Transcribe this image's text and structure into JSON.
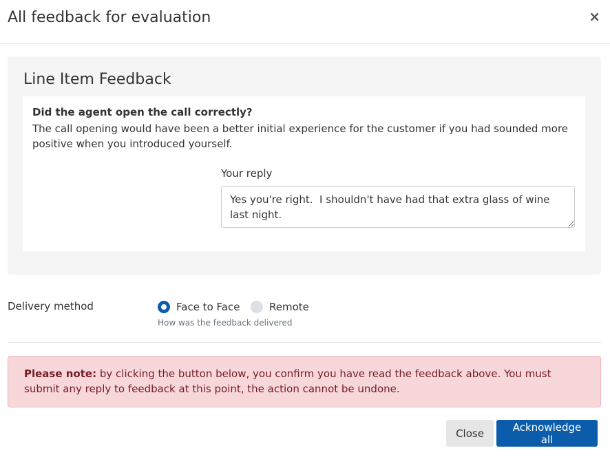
{
  "modal": {
    "title": "All feedback for evaluation",
    "close_icon": "×"
  },
  "panel": {
    "title": "Line Item Feedback",
    "question": "Did the agent open the call correctly?",
    "comment": "The call opening would have been a better initial experience for the customer if you had sounded more positive when you introduced yourself.",
    "reply_label": "Your reply",
    "reply_value": "Yes you're right.  I shouldn't have had that extra glass of wine last night."
  },
  "delivery": {
    "label": "Delivery method",
    "options": [
      {
        "label": "Face to Face",
        "selected": true
      },
      {
        "label": "Remote",
        "selected": false
      }
    ],
    "help": "How was the feedback delivered"
  },
  "alert": {
    "bold": "Please note:",
    "text": " by clicking the button below, you confirm you have read the feedback above. You must submit any reply to feedback at this point, the action cannot be undone."
  },
  "footer": {
    "close_label": "Close",
    "acknowledge_label": "Acknowledge all"
  },
  "colors": {
    "primary": "#0b5cab",
    "alert_bg": "#f8d7da",
    "alert_text": "#721c24"
  }
}
